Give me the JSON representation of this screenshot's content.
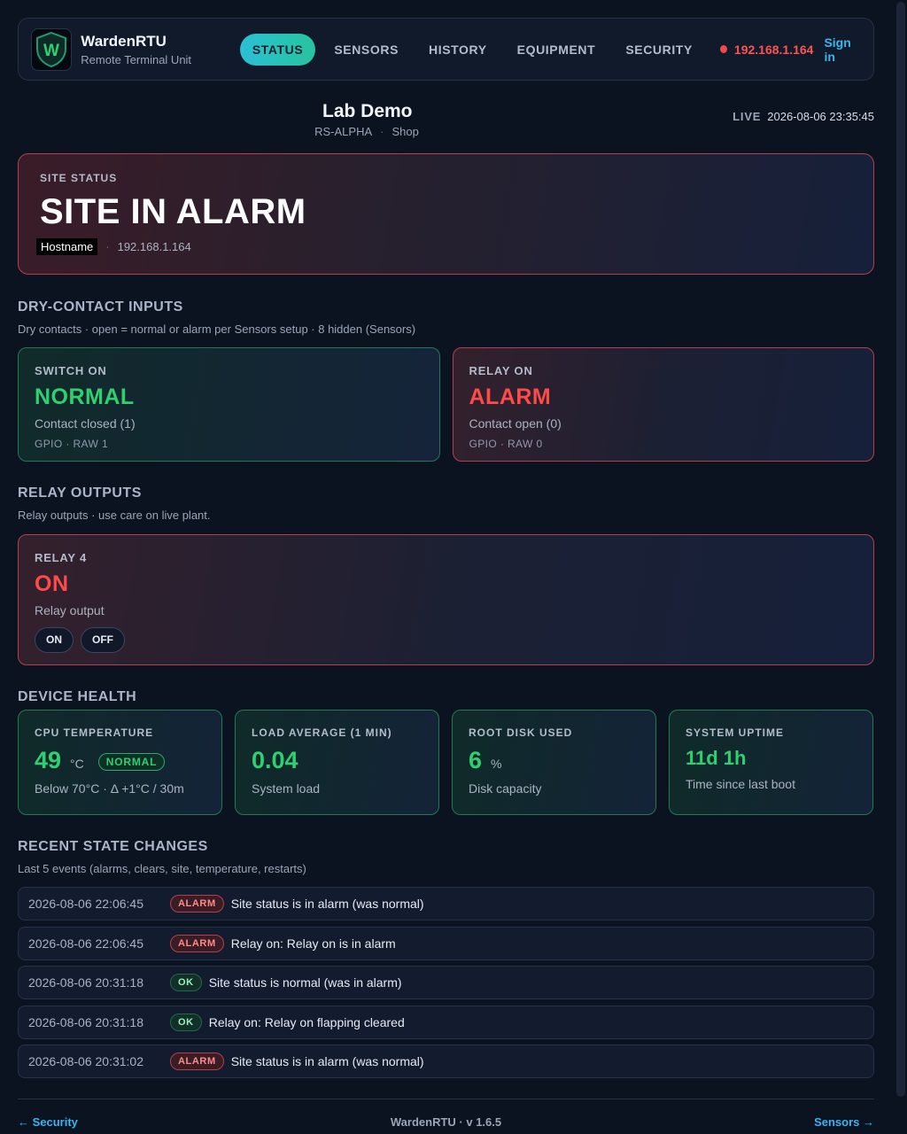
{
  "app": {
    "name": "WardenRTU",
    "subtitle": "Remote Terminal Unit",
    "logo_letter": "W"
  },
  "nav": {
    "items": [
      {
        "label": "STATUS",
        "active": true
      },
      {
        "label": "SENSORS",
        "active": false
      },
      {
        "label": "HISTORY",
        "active": false
      },
      {
        "label": "EQUIPMENT",
        "active": false
      },
      {
        "label": "SECURITY",
        "active": false
      }
    ],
    "ip": "192.168.1.164",
    "signin": "Sign in"
  },
  "site": {
    "name": "Lab Demo",
    "code": "RS-ALPHA",
    "location": "Shop",
    "live_label": "LIVE",
    "timestamp": "2026-08-06 23:35:45"
  },
  "site_status": {
    "caption": "SITE STATUS",
    "state": "SITE IN ALARM",
    "hostname_label": "Hostname",
    "ip": "192.168.1.164"
  },
  "dry_contacts": {
    "title": "DRY-CONTACT INPUTS",
    "subtitle": "Dry contacts · open = normal or alarm per Sensors setup · 8 hidden (Sensors)",
    "cards": [
      {
        "label": "SWITCH ON",
        "state": "NORMAL",
        "detail": "Contact closed (1)",
        "raw": "GPIO · RAW 1",
        "kind": "ok"
      },
      {
        "label": "RELAY ON",
        "state": "ALARM",
        "detail": "Contact open (0)",
        "raw": "GPIO · RAW 0",
        "kind": "alarm"
      }
    ]
  },
  "relays": {
    "title": "RELAY OUTPUTS",
    "subtitle": "Relay outputs · use care on live plant.",
    "card": {
      "label": "RELAY 4",
      "state": "ON",
      "detail": "Relay output",
      "on_label": "ON",
      "off_label": "OFF"
    }
  },
  "health": {
    "title": "DEVICE HEALTH",
    "cards": [
      {
        "label": "CPU TEMPERATURE",
        "value": "49",
        "unit": "°C",
        "badge": "NORMAL",
        "desc": "Below 70°C · Δ +1°C / 30m"
      },
      {
        "label": "LOAD AVERAGE (1 MIN)",
        "value": "0.04",
        "unit": "",
        "desc": "System load"
      },
      {
        "label": "ROOT DISK USED",
        "value": "6",
        "unit": "%",
        "desc": "Disk capacity"
      },
      {
        "label": "SYSTEM UPTIME",
        "value": "11d 1h",
        "unit": "",
        "desc": "Time since last boot"
      }
    ]
  },
  "events": {
    "title": "RECENT STATE CHANGES",
    "subtitle": "Last 5 events (alarms, clears, site, temperature, restarts)",
    "items": [
      {
        "ts": "2026-08-06 22:06:45",
        "tag": "ALARM",
        "kind": "alarm",
        "msg": "Site status is in alarm (was normal)"
      },
      {
        "ts": "2026-08-06 22:06:45",
        "tag": "ALARM",
        "kind": "alarm",
        "msg": "Relay on: Relay on is in alarm"
      },
      {
        "ts": "2026-08-06 20:31:18",
        "tag": "OK",
        "kind": "ok",
        "msg": "Site status is normal (was in alarm)"
      },
      {
        "ts": "2026-08-06 20:31:18",
        "tag": "OK",
        "kind": "ok",
        "msg": "Relay on: Relay on flapping cleared"
      },
      {
        "ts": "2026-08-06 20:31:02",
        "tag": "ALARM",
        "kind": "alarm",
        "msg": "Site status is in alarm (was normal)"
      }
    ]
  },
  "footer": {
    "prev": "← Security",
    "version": "WardenRTU · v  1.6.5",
    "next": "Sensors →"
  },
  "colors": {
    "accent": "#2bc0d4",
    "alarm": "#ff4a4a",
    "ok": "#2ed070",
    "link": "#38b6f0"
  }
}
